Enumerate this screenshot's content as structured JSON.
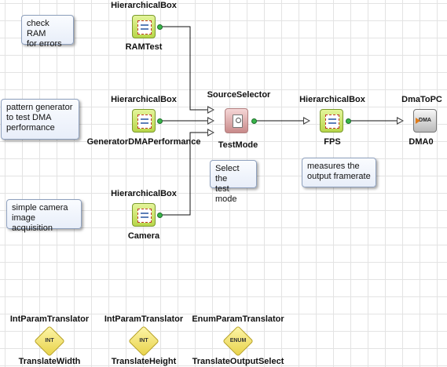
{
  "notes": {
    "check_ram": "check RAM\nfor errors",
    "pattern_generator": "pattern generator\nto test DMA\nperformance",
    "camera": "simple camera\nimage acquisition",
    "select_test": "Select the\ntest mode",
    "measures": "measures the\noutput framerate"
  },
  "nodes": {
    "ramtest": {
      "type": "HierarchicalBox",
      "name": "RAMTest"
    },
    "generator": {
      "type": "HierarchicalBox",
      "name": "GeneratorDMAPerformance"
    },
    "camera": {
      "type": "HierarchicalBox",
      "name": "Camera"
    },
    "testmode": {
      "type": "SourceSelector",
      "name": "TestMode"
    },
    "fps": {
      "type": "HierarchicalBox",
      "name": "FPS"
    },
    "dma0": {
      "type": "DmaToPC",
      "name": "DMA0",
      "icon_text": "DMA"
    }
  },
  "translators": [
    {
      "type": "IntParamTranslator",
      "name": "TranslateWidth",
      "icon_text": "INT"
    },
    {
      "type": "IntParamTranslator",
      "name": "TranslateHeight",
      "icon_text": "INT"
    },
    {
      "type": "EnumParamTranslator",
      "name": "TranslateOutputSelect",
      "icon_text": "ENUM"
    }
  ],
  "colors": {
    "accent_green": "#39b54a",
    "hbox_fill": "#c8e35a",
    "selector_fill": "#d9a3a3",
    "grid": "#e3e3e3"
  }
}
